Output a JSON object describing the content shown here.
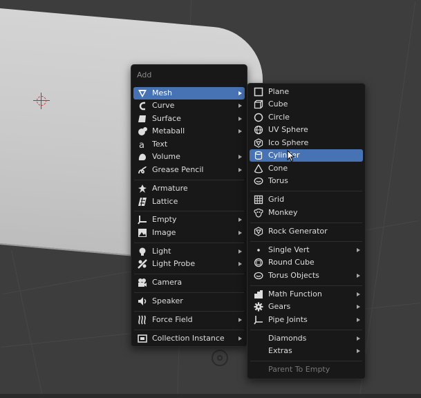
{
  "add_menu": {
    "title": "Add",
    "items": [
      {
        "label": "Mesh",
        "icon": "mesh-icon"
      },
      {
        "label": "Curve",
        "icon": "curve-icon"
      },
      {
        "label": "Surface",
        "icon": "surface-icon"
      },
      {
        "label": "Metaball",
        "icon": "metaball-icon"
      },
      {
        "label": "Text",
        "icon": "text-icon"
      },
      {
        "label": "Volume",
        "icon": "volume-icon"
      },
      {
        "label": "Grease Pencil",
        "icon": "grease-pencil-icon"
      },
      {
        "label": "Armature",
        "icon": "armature-icon"
      },
      {
        "label": "Lattice",
        "icon": "lattice-icon"
      },
      {
        "label": "Empty",
        "icon": "empty-icon"
      },
      {
        "label": "Image",
        "icon": "image-icon"
      },
      {
        "label": "Light",
        "icon": "light-icon"
      },
      {
        "label": "Light Probe",
        "icon": "light-probe-icon"
      },
      {
        "label": "Camera",
        "icon": "camera-icon"
      },
      {
        "label": "Speaker",
        "icon": "speaker-icon"
      },
      {
        "label": "Force Field",
        "icon": "force-field-icon"
      },
      {
        "label": "Collection Instance",
        "icon": "collection-instance-icon"
      }
    ]
  },
  "mesh_menu": {
    "items": [
      {
        "label": "Plane",
        "icon": "plane-icon"
      },
      {
        "label": "Cube",
        "icon": "cube-icon"
      },
      {
        "label": "Circle",
        "icon": "circle-icon"
      },
      {
        "label": "UV Sphere",
        "icon": "uv-sphere-icon"
      },
      {
        "label": "Ico Sphere",
        "icon": "ico-sphere-icon"
      },
      {
        "label": "Cylinder",
        "icon": "cylinder-icon"
      },
      {
        "label": "Cone",
        "icon": "cone-icon"
      },
      {
        "label": "Torus",
        "icon": "torus-icon"
      },
      {
        "label": "Grid",
        "icon": "grid-icon"
      },
      {
        "label": "Monkey",
        "icon": "monkey-icon"
      },
      {
        "label": "Rock Generator",
        "icon": "rock-icon"
      },
      {
        "label": "Single Vert",
        "icon": "dot-icon"
      },
      {
        "label": "Round Cube",
        "icon": "round-cube-icon"
      },
      {
        "label": "Torus Objects",
        "icon": "torus-objects-icon"
      },
      {
        "label": "Math Function",
        "icon": "math-function-icon"
      },
      {
        "label": "Gears",
        "icon": "gear-icon"
      },
      {
        "label": "Pipe Joints",
        "icon": "pipe-joints-icon"
      },
      {
        "label": "Diamonds",
        "icon": ""
      },
      {
        "label": "Extras",
        "icon": ""
      },
      {
        "label": "Parent To Empty",
        "icon": ""
      }
    ]
  },
  "colors": {
    "highlight": "#4772b3",
    "menu_bg": "#181818",
    "viewport_bg": "#3d3d3d"
  }
}
